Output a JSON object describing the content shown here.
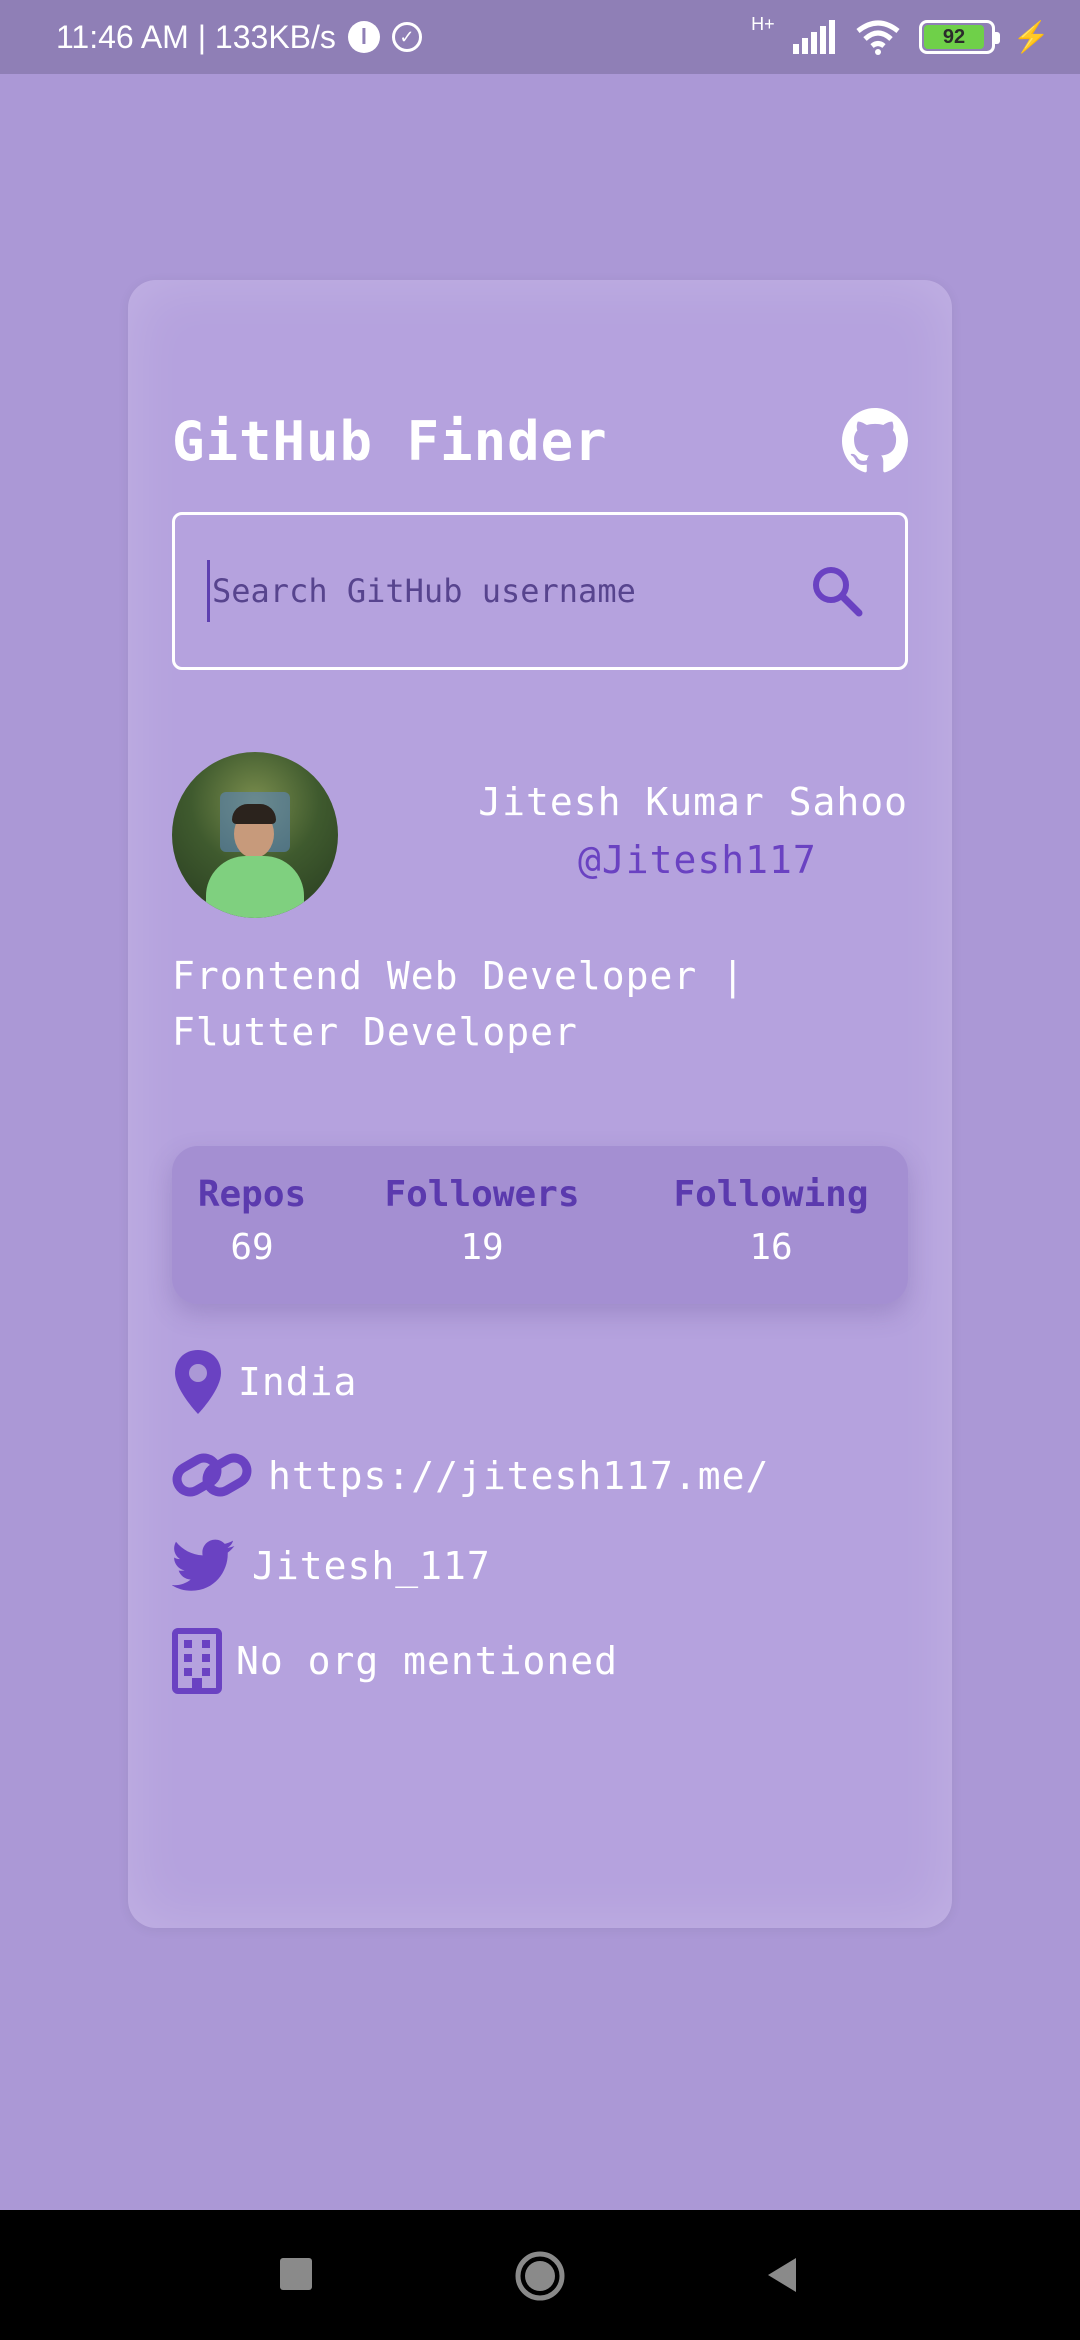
{
  "status_bar": {
    "time_speed": "11:46 AM | 133KB/s",
    "app_glyph": "l",
    "network": "H+",
    "battery": "92"
  },
  "card": {
    "title": "GitHub Finder",
    "search": {
      "placeholder": "Search GitHub username"
    },
    "profile": {
      "name": "Jitesh Kumar Sahoo",
      "username": "@Jitesh117",
      "bio": "Frontend Web Developer | Flutter Developer"
    },
    "stats": [
      {
        "label": "Repos",
        "value": "69"
      },
      {
        "label": "Followers",
        "value": "19"
      },
      {
        "label": "Following",
        "value": "16"
      }
    ],
    "info": {
      "location": "India",
      "blog": "https://jitesh117.me/",
      "twitter": "Jitesh_117",
      "company": "No org mentioned"
    }
  },
  "colors": {
    "background": "#ab98d6",
    "accent": "#6a42c2",
    "stat_label": "#5b3aae",
    "text": "#ffffff"
  },
  "icons": [
    "github-icon",
    "search-icon",
    "location-icon",
    "link-icon",
    "twitter-icon",
    "building-icon"
  ]
}
